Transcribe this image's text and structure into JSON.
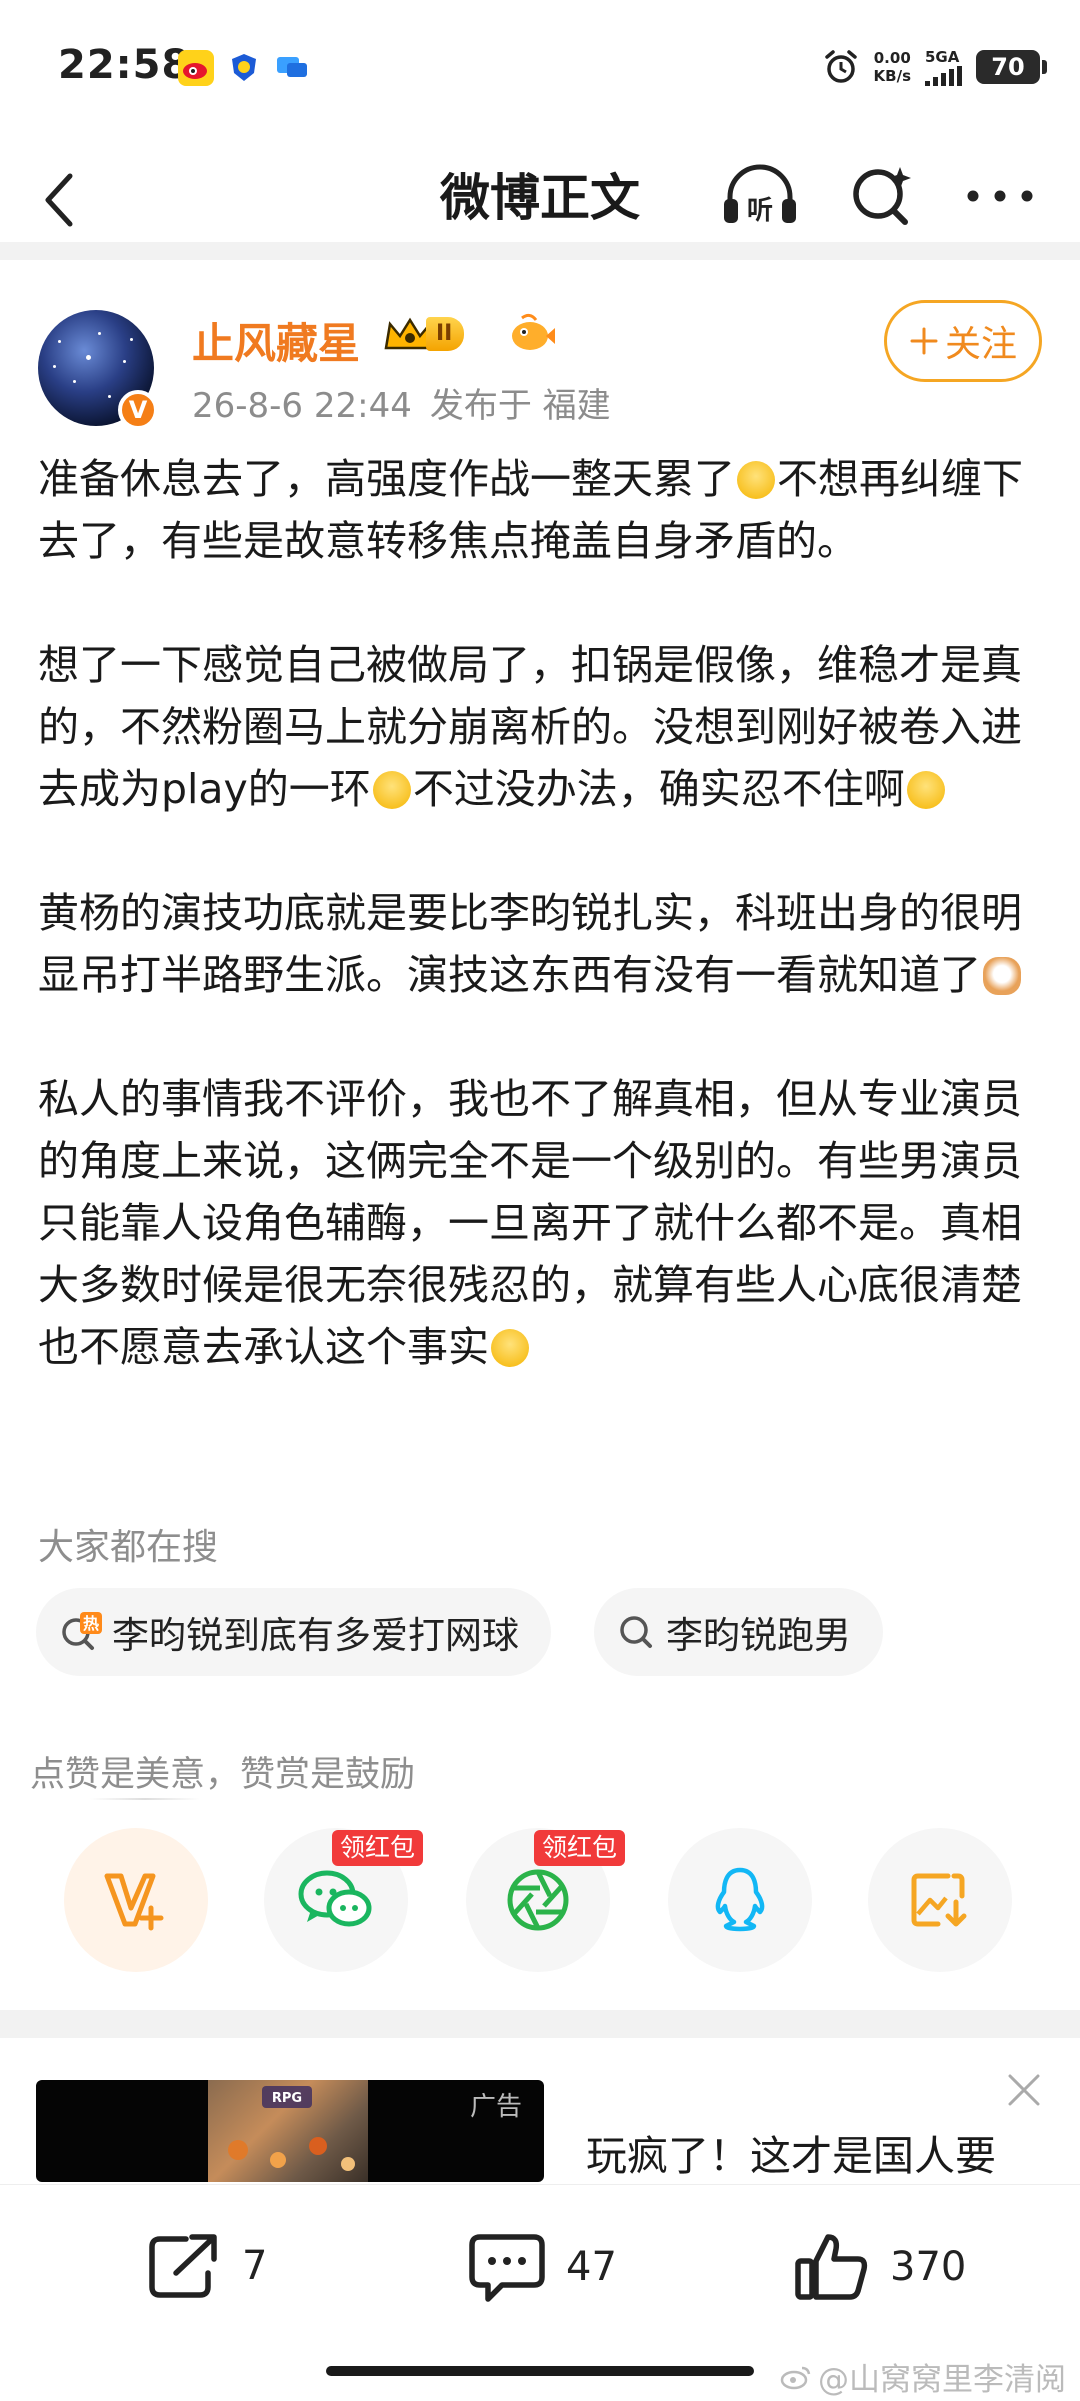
{
  "status_bar": {
    "time": "22:58",
    "net_speed_value": "0.00",
    "net_speed_unit": "KB/s",
    "signal_label": "5GA",
    "battery": "70"
  },
  "nav": {
    "title": "微博正文",
    "listen_label": "听"
  },
  "post": {
    "author": "止风藏星",
    "rank": "II",
    "date": "26-8-6 22:44",
    "location": "发布于 福建",
    "follow_label": "关注",
    "p1a": "准备休息去了，高强度作战一整天累了",
    "p1b": "不想再纠缠下去了，有些是故意转移焦点掩盖自身矛盾的。",
    "p2a": "想了一下感觉自己被做局了，扣锅是假像，维稳才是真的，不然粉圈马上就分崩离析的。没想到刚好被卷入进去成为play的一环",
    "p2b": "不过没办法，确实忍不住啊",
    "p3a": "黄杨的演技功底就是要比李昀锐扎实，科班出身的很明显吊打半路野生派。演技这东西有没有一看就知道了",
    "p4a": "私人的事情我不评价，我也不了解真相，但从专业演员的角度上来说，这俩完全不是一个级别的。有些男演员只能靠人设角色辅酶，一旦离开了就什么都不是。真相大多数时候是很无奈很残忍的，就算有些人心底很清楚也不愿意去承认这个事实"
  },
  "hot_search": {
    "title": "大家都在搜",
    "hot_badge": "热",
    "items": [
      "李昀锐到底有多爱打网球",
      "李昀锐跑男"
    ]
  },
  "share": {
    "tip": "点赞是美意，赞赏是鼓励",
    "redpack_label": "领红包"
  },
  "ad": {
    "label": "广告",
    "title": "玩疯了！这才是国人要",
    "img_text": "RPG"
  },
  "actions": {
    "reposts": "7",
    "comments": "47",
    "likes": "370"
  },
  "watermark": "@山窝窝里李清阅",
  "colors": {
    "brand_orange": "#f07a20",
    "follow_border": "#f5a623",
    "redpack": "#f13a3a",
    "wechat_green": "#1ab65f",
    "moments_green": "#2bb34a",
    "qq_blue": "#12b7f5",
    "save_orange": "#f5a623"
  }
}
